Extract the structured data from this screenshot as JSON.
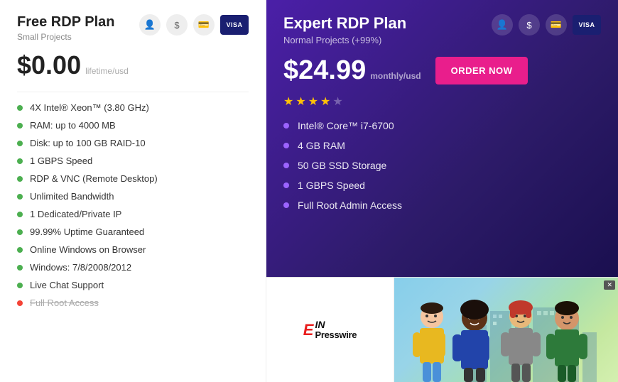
{
  "left": {
    "title": "Free RDP Plan",
    "subtitle": "Small Projects",
    "price": "$0.00",
    "price_period": "lifetime/usd",
    "icons": [
      "user",
      "$",
      "card",
      "visa"
    ],
    "features": [
      {
        "text": "4X Intel® Xeon™ (3.80 GHz)",
        "dot": "green",
        "strikethrough": false
      },
      {
        "text": "RAM: up to 4000 MB",
        "dot": "green",
        "strikethrough": false
      },
      {
        "text": "Disk: up to 100 GB RAID-10",
        "dot": "green",
        "strikethrough": false
      },
      {
        "text": "1 GBPS Speed",
        "dot": "green",
        "strikethrough": false
      },
      {
        "text": "RDP & VNC (Remote Desktop)",
        "dot": "green",
        "strikethrough": false
      },
      {
        "text": "Unlimited Bandwidth",
        "dot": "green",
        "strikethrough": false
      },
      {
        "text": "1 Dedicated/Private IP",
        "dot": "green",
        "strikethrough": false
      },
      {
        "text": "99.99% Uptime Guaranteed",
        "dot": "green",
        "strikethrough": false
      },
      {
        "text": "Online Windows on Browser",
        "dot": "green",
        "strikethrough": false
      },
      {
        "text": "Windows: 7/8/2008/2012",
        "dot": "green",
        "strikethrough": false
      },
      {
        "text": "Live Chat Support",
        "dot": "green",
        "strikethrough": false
      },
      {
        "text": "Full Root Access",
        "dot": "red",
        "strikethrough": true
      }
    ]
  },
  "right": {
    "title": "Expert RDP Plan",
    "subtitle": "Normal Projects (+99%)",
    "price": "$24.99",
    "price_period": "monthly/usd",
    "order_btn": "ORDER NOW",
    "stars": 3.5,
    "features": [
      {
        "text": "Intel® Core™ i7-6700"
      },
      {
        "text": "4 GB RAM"
      },
      {
        "text": "50 GB SSD Storage"
      },
      {
        "text": "1 GBPS Speed"
      },
      {
        "text": "Full Root Admin Access"
      }
    ]
  },
  "ad": {
    "logo_text": "EINPresswire",
    "close": "✕"
  }
}
